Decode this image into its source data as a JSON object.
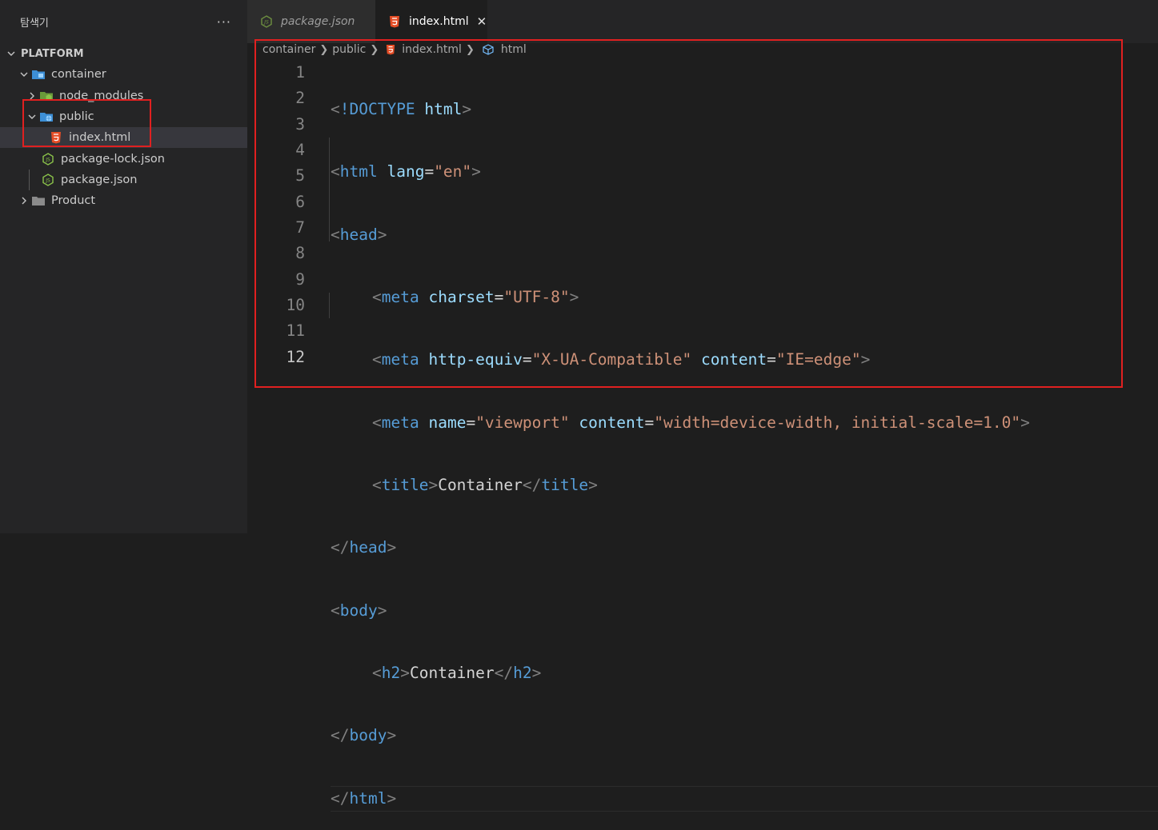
{
  "sidebar": {
    "title": "탐색기",
    "more_label": "···",
    "root_label": "PLATFORM",
    "items": [
      {
        "label": "container"
      },
      {
        "label": "node_modules"
      },
      {
        "label": "public"
      },
      {
        "label": "index.html"
      },
      {
        "label": "package-lock.json"
      },
      {
        "label": "package.json"
      },
      {
        "label": "Product"
      }
    ]
  },
  "tabs": [
    {
      "label": "package.json"
    },
    {
      "label": "index.html",
      "close": "✕"
    }
  ],
  "breadcrumb": [
    "container",
    "public",
    "index.html",
    "html"
  ],
  "editor": {
    "line_numbers": [
      "1",
      "2",
      "3",
      "4",
      "5",
      "6",
      "7",
      "8",
      "9",
      "10",
      "11",
      "12"
    ],
    "l1": {
      "lt": "<",
      "doctype": "!DOCTYPE",
      "html": "html",
      "gt": ">"
    },
    "l2": {
      "lt": "<",
      "tag": "html",
      "attr": "lang",
      "eq": "=",
      "val": "\"en\"",
      "gt": ">"
    },
    "l3": {
      "lt": "<",
      "tag": "head",
      "gt": ">"
    },
    "l4": {
      "lt": "<",
      "tag": "meta",
      "attr": "charset",
      "eq": "=",
      "val": "\"UTF-8\"",
      "gt": ">"
    },
    "l5": {
      "lt": "<",
      "tag": "meta",
      "attr1": "http-equiv",
      "eq1": "=",
      "val1": "\"X-UA-Compatible\"",
      "attr2": "content",
      "eq2": "=",
      "val2": "\"IE=edge\"",
      "gt": ">"
    },
    "l6": {
      "lt": "<",
      "tag": "meta",
      "attr1": "name",
      "eq1": "=",
      "val1": "\"viewport\"",
      "attr2": "content",
      "eq2": "=",
      "val2": "\"width=device-width, initial-scale=1.0\"",
      "gt": ">"
    },
    "l7": {
      "lt": "<",
      "tag": "title",
      "gt": ">",
      "text": "Container",
      "lt2": "</",
      "tag2": "title",
      "gt2": ">"
    },
    "l8": {
      "lt": "</",
      "tag": "head",
      "gt": ">"
    },
    "l9": {
      "lt": "<",
      "tag": "body",
      "gt": ">"
    },
    "l10": {
      "lt": "<",
      "tag": "h2",
      "gt": ">",
      "text": "Container",
      "lt2": "</",
      "tag2": "h2",
      "gt2": ">"
    },
    "l11": {
      "lt": "</",
      "tag": "body",
      "gt": ">"
    },
    "l12": {
      "lt": "</",
      "tag": "html",
      "gt": ">"
    }
  },
  "colors": {
    "highlight": "#e02020",
    "tag": "#569cd6",
    "attribute": "#9cdcfe",
    "string": "#ce9178",
    "punctuation": "#808080",
    "html_icon": "#e44d26",
    "json_icon": "#8bc34a",
    "folder_blue": "#3d8fd6"
  }
}
